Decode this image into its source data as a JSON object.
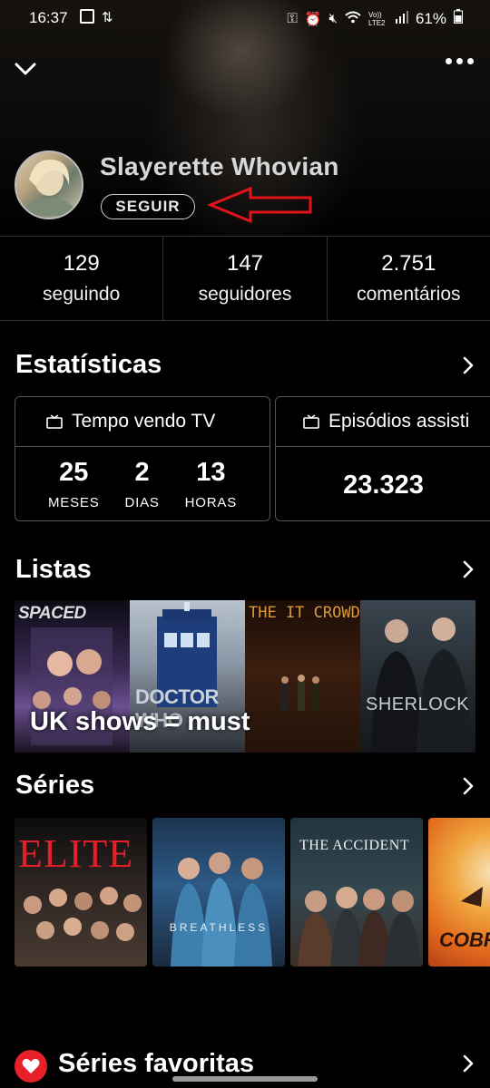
{
  "status_bar": {
    "time": "16:37",
    "battery": "61%",
    "network": "Vo)) LTE2"
  },
  "profile": {
    "name": "Slayerette Whovian",
    "follow_label": "SEGUIR"
  },
  "stats": [
    {
      "value": "129",
      "label": "seguindo"
    },
    {
      "value": "147",
      "label": "seguidores"
    },
    {
      "value": "2.751",
      "label": "comentários"
    }
  ],
  "statistics": {
    "title": "Estatísticas",
    "tv_time": {
      "title": "Tempo vendo TV",
      "months": "25",
      "months_label": "MESES",
      "days": "2",
      "days_label": "DIAS",
      "hours": "13",
      "hours_label": "HORAS"
    },
    "episodes": {
      "title": "Episódios assisti",
      "value": "23.323"
    }
  },
  "lists": {
    "title": "Listas",
    "list_name": "UK shows = must",
    "covers": [
      "SPACED",
      "DOCTOR WHO",
      "THE IT CROWD",
      "SHERLOCK"
    ]
  },
  "series": {
    "title": "Séries",
    "posters": [
      "ELITE",
      "BREATHLESS",
      "THE ACCIDENT",
      "COBRA"
    ]
  },
  "favorites": {
    "title": "Séries favoritas"
  },
  "colors": {
    "accent_red": "#e8202a",
    "background": "#000000"
  }
}
